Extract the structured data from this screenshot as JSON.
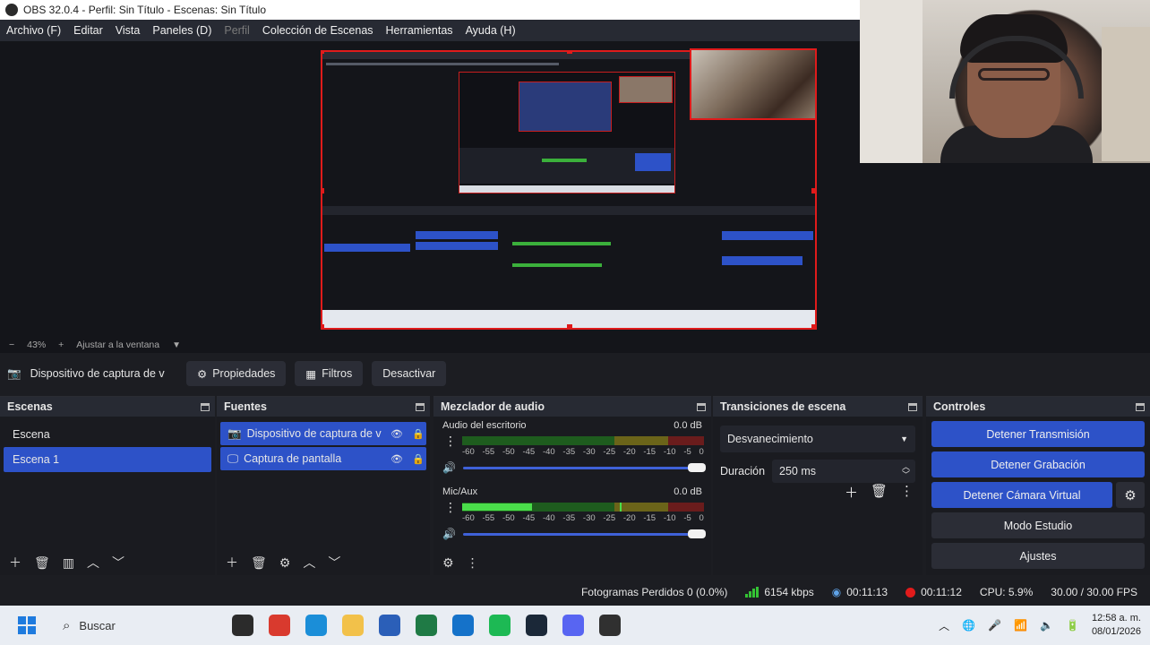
{
  "window": {
    "title": "OBS 32.0.4 - Perfil: Sin Título - Escenas: Sin Título"
  },
  "menu": {
    "items": [
      "Archivo (F)",
      "Editar",
      "Vista",
      "Paneles (D)",
      "Perfil",
      "Colección de Escenas",
      "Herramientas",
      "Ayuda (H)"
    ]
  },
  "zoom": {
    "minus": "−",
    "level": "43%",
    "plus": "+",
    "fit": "Ajustar a la ventana"
  },
  "source_toolbar": {
    "source_name": "Dispositivo de captura de v",
    "properties": "Propiedades",
    "filters": "Filtros",
    "deactivate": "Desactivar"
  },
  "scenes": {
    "title": "Escenas",
    "items": [
      {
        "label": "Escena",
        "selected": false
      },
      {
        "label": "Escena 1",
        "selected": true
      }
    ]
  },
  "sources": {
    "title": "Fuentes",
    "items": [
      {
        "label": "Dispositivo de captura de v",
        "icon": "camera-icon"
      },
      {
        "label": "Captura de pantalla",
        "icon": "monitor-icon"
      }
    ]
  },
  "mixer": {
    "title": "Mezclador de audio",
    "scale": [
      "-60",
      "-55",
      "-50",
      "-45",
      "-40",
      "-35",
      "-30",
      "-25",
      "-20",
      "-15",
      "-10",
      "-5",
      "0"
    ],
    "channels": [
      {
        "name": "Audio del escritorio",
        "db": "0.0 dB",
        "level": 0.0,
        "volume": 1.0
      },
      {
        "name": "Mic/Aux",
        "db": "0.0 dB",
        "level": 0.29,
        "peak": 0.65,
        "volume": 1.0
      }
    ]
  },
  "transitions": {
    "title": "Transiciones de escena",
    "selected": "Desvanecimiento",
    "duration_label": "Duración",
    "duration_value": "250 ms"
  },
  "controls": {
    "title": "Controles",
    "stop_stream": "Detener Transmisión",
    "stop_recording": "Detener Grabación",
    "stop_virtual_cam": "Detener Cámara Virtual",
    "studio_mode": "Modo Estudio",
    "settings": "Ajustes"
  },
  "status": {
    "dropped_frames": "Fotogramas Perdidos 0 (0.0%)",
    "bitrate": "6154 kbps",
    "stream_time": "00:11:13",
    "rec_time": "00:11:12",
    "cpu": "CPU: 5.9%",
    "fps": "30.00 / 30.00 FPS"
  },
  "taskbar": {
    "search_placeholder": "Buscar",
    "time": "12:58 a. m.",
    "date": "08/01/2026",
    "apps": [
      {
        "name": "file-explorer-dark-icon",
        "color": "#2b2b2b"
      },
      {
        "name": "chrome-icon",
        "color": "#d93a2e"
      },
      {
        "name": "edge-icon",
        "color": "#1b8ed8"
      },
      {
        "name": "folder-icon",
        "color": "#f2c14a"
      },
      {
        "name": "word-icon",
        "color": "#2b5fb8"
      },
      {
        "name": "excel-icon",
        "color": "#1f7a45"
      },
      {
        "name": "outlook-icon",
        "color": "#1572c9"
      },
      {
        "name": "spotify-icon",
        "color": "#1db954"
      },
      {
        "name": "steam-icon",
        "color": "#1b2838"
      },
      {
        "name": "discord-icon",
        "color": "#5865f2"
      },
      {
        "name": "obs-icon",
        "color": "#303030"
      }
    ]
  },
  "colors": {
    "accent": "#2d52c8",
    "rec": "#e11b1b",
    "selection_border": "#e01b1b"
  }
}
